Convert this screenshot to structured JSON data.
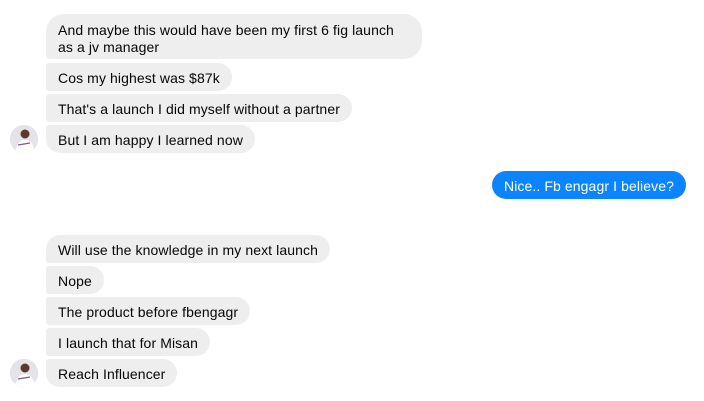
{
  "conversation": {
    "group1": [
      "And maybe this would have been my first 6 fig launch as a jv manager",
      "Cos my highest was $87k",
      "That's a launch I did myself without a partner",
      "But I am happy I learned now"
    ],
    "outgoing": [
      "Nice.. Fb engagr I believe?"
    ],
    "group2": [
      "Will use the knowledge in my next launch",
      "Nope",
      "The product before fbengagr",
      "I launch that for Misan",
      "Reach Influencer"
    ]
  },
  "colors": {
    "incoming_bubble": "#eeeeee",
    "outgoing_bubble": "#0a84ff",
    "incoming_text": "#050505",
    "outgoing_text": "#ffffff"
  },
  "icons": {
    "avatar": "contact-avatar-icon"
  }
}
